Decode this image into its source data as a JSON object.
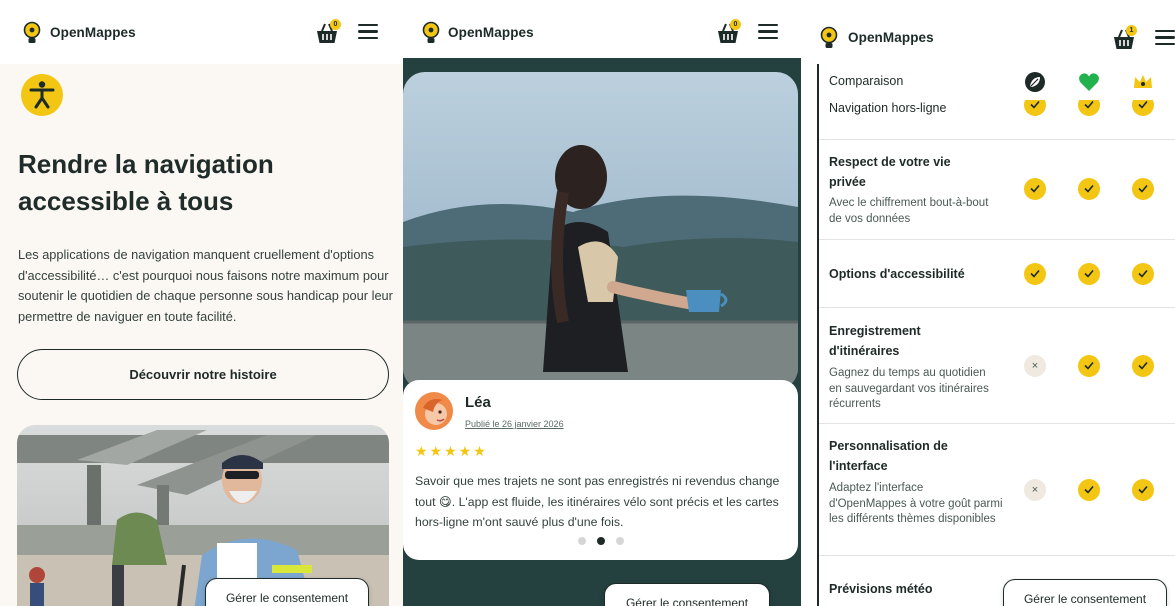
{
  "brand": "OpenMappes",
  "basket_count": "0",
  "basket_count_p3": "1",
  "colors": {
    "accent": "#f3c613",
    "dark": "#1e2a27",
    "dark_teal": "#24403f",
    "panel_bg": "#fbf8f4"
  },
  "panel1": {
    "hero_icon": "accessibility-icon",
    "title": "Rendre la navigation accessible à tous",
    "body": "Les applications de navigation manquent cruellement d'options d'accessibilité… c'est pourquoi nous faisons notre maximum pour soutenir le quotidien de chaque personne sous handicap pour leur permettre de naviguer en toute facilité.",
    "discover_button": "Découvrir notre histoire",
    "consent_button": "Gérer le consentement"
  },
  "panel2": {
    "reviewer": "Léa",
    "date": "Publié le 26 janvier 2026",
    "rating": 5,
    "stars": "★★★★★",
    "text": "Savoir que mes trajets ne sont pas enregistrés ni revendus change tout 😋. L'app est fluide, les itinéraires vélo sont précis et les cartes hors-ligne m'ont sauvé plus d'une fois.",
    "consent_button": "Gérer le consentement"
  },
  "panel3": {
    "header": "Comparaison",
    "column_icons": [
      "leaf-icon",
      "heart-icon",
      "crown-icon"
    ],
    "clipped_row": "Navigation hors-ligne",
    "rows": [
      {
        "title": "Respect de votre vie privée",
        "desc": "Avec le chiffrement bout-à-bout de vos données"
      },
      {
        "title": "Options d'accessibilité",
        "desc": ""
      },
      {
        "title": "Enregistrement d'itinéraires",
        "desc": "Gagnez du temps au quotidien en sauvegardant vos itinéraires récurrents"
      },
      {
        "title": "Personnalisation de l'interface",
        "desc": "Adaptez l'interface d'OpenMappes à votre goût parmi les différents thèmes disponibles"
      },
      {
        "title": "Prévisions météo",
        "desc": ""
      }
    ],
    "cross_symbol": "×",
    "consent_button": "Gérer le consentement"
  }
}
